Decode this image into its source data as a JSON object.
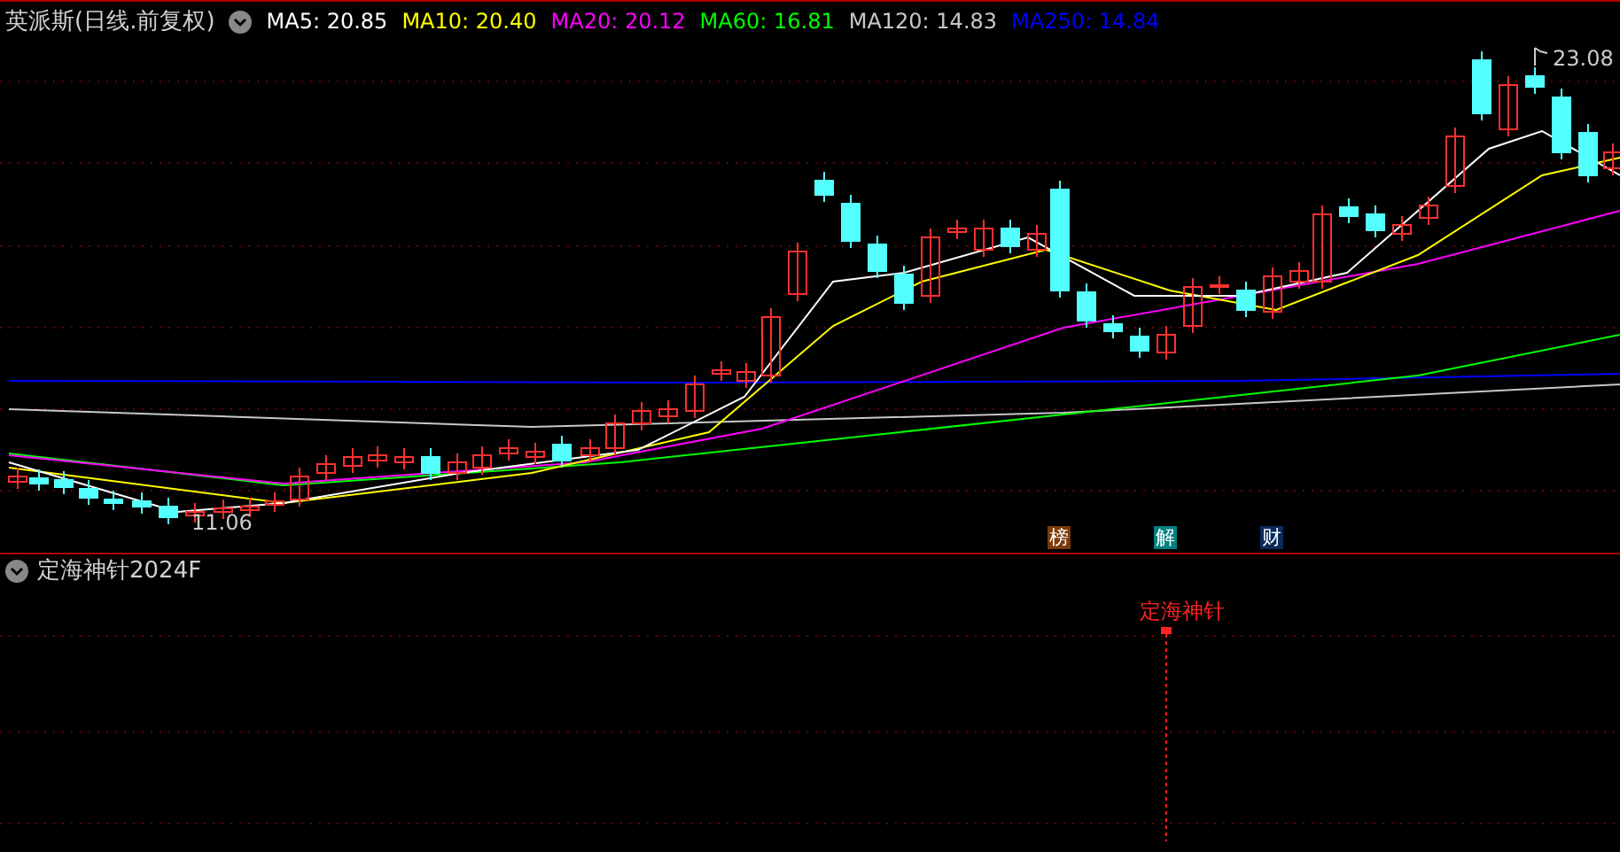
{
  "main_chart": {
    "title": "英派斯(日线.前复权)",
    "indicators": [
      {
        "label": "MA5: 20.85",
        "color": "#ffffff"
      },
      {
        "label": "MA10: 20.40",
        "color": "#ffff00"
      },
      {
        "label": "MA20: 20.12",
        "color": "#ff00ff"
      },
      {
        "label": "MA60: 16.81",
        "color": "#00ff00"
      },
      {
        "label": "MA120: 14.83",
        "color": "#c8c8c8"
      },
      {
        "label": "MA250: 14.84",
        "color": "#0000ff"
      }
    ],
    "high_label": "23.08",
    "low_label": "11.06",
    "event_badges": [
      {
        "text": "榜",
        "color": "#7a3a0a"
      },
      {
        "text": "解",
        "color": "#008080"
      },
      {
        "text": "财",
        "color": "#0a2a5a"
      }
    ]
  },
  "sub_chart": {
    "title": "定海神针2024F",
    "signal_label": "定海神针"
  }
}
